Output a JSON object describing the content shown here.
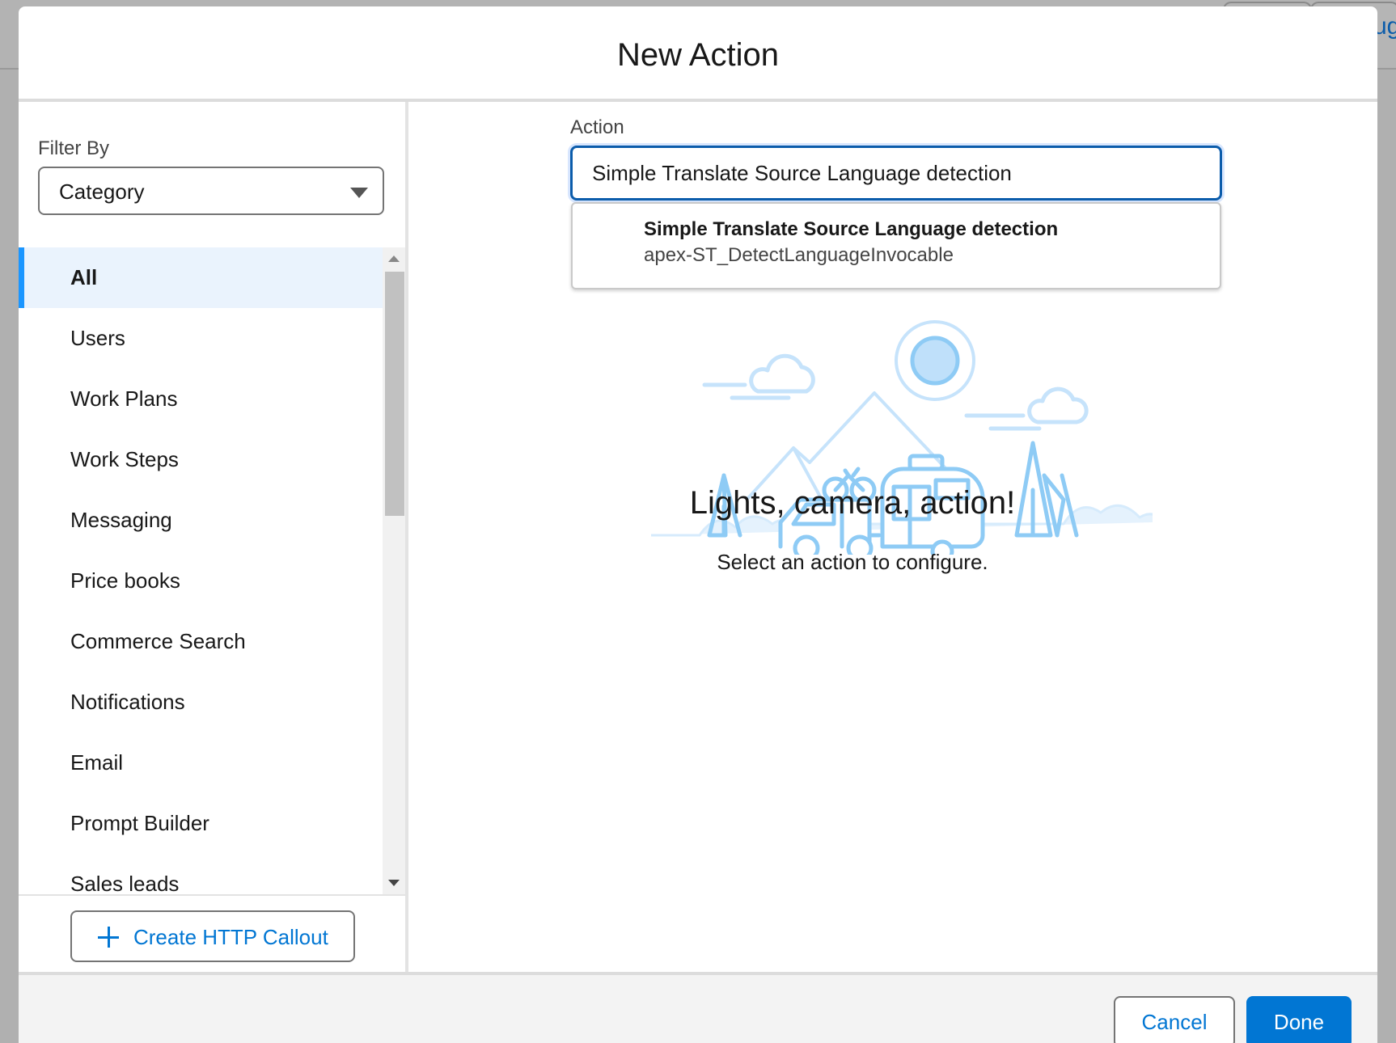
{
  "background": {
    "link_fragment": "ug"
  },
  "modal": {
    "title": "New Action"
  },
  "sidebar": {
    "filter_label": "Filter By",
    "filter_value": "Category",
    "categories": [
      {
        "label": "All",
        "active": true
      },
      {
        "label": "Users"
      },
      {
        "label": "Work Plans"
      },
      {
        "label": "Work Steps"
      },
      {
        "label": "Messaging"
      },
      {
        "label": "Price books"
      },
      {
        "label": "Commerce Search"
      },
      {
        "label": "Notifications"
      },
      {
        "label": "Email"
      },
      {
        "label": "Prompt Builder"
      },
      {
        "label": "Sales leads"
      }
    ],
    "create_button_label": "Create HTTP Callout"
  },
  "main": {
    "action_label": "Action",
    "action_value": "Simple Translate Source Language detection",
    "suggestion": {
      "title": "Simple Translate Source Language detection",
      "subtitle": "apex-ST_DetectLanguageInvocable"
    },
    "empty_title": "Lights, camera, action!",
    "empty_subtitle": "Select an action to configure."
  },
  "footer": {
    "cancel_label": "Cancel",
    "done_label": "Done"
  },
  "colors": {
    "brand": "#0176d3",
    "accent": "#1b96ff",
    "focus": "#0b5cab",
    "illustration": "#8ecbf5"
  }
}
